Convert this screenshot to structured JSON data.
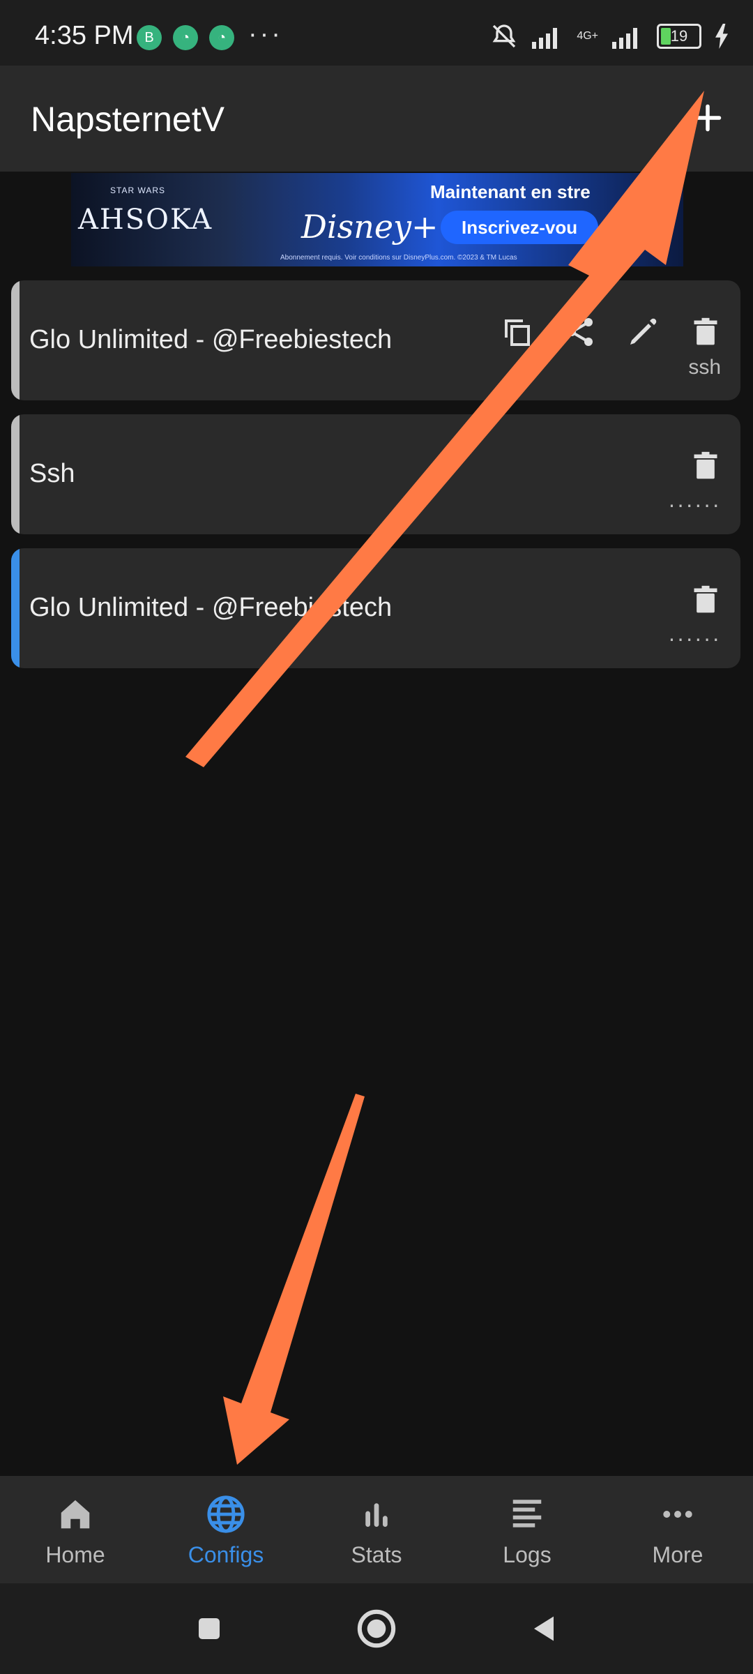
{
  "status_bar": {
    "time": "4:35 PM",
    "overflow": "···",
    "network": "4G+",
    "battery": "19"
  },
  "app_bar": {
    "title": "NapsternetV"
  },
  "ad": {
    "brand_small": "STAR WARS",
    "show": "AHSOKA",
    "disney": "Disney+",
    "headline": "Maintenant en stre",
    "cta": "Inscrivez-vou",
    "fine_print": "Abonnement requis. Voir conditions sur DisneyPlus.com. ©2023 & TM Lucas"
  },
  "configs": [
    {
      "title": "Glo Unlimited - @Freebiestech",
      "tag": "ssh",
      "expanded": true,
      "selected": false
    },
    {
      "title": "Ssh",
      "tag": "······",
      "expanded": false,
      "selected": false
    },
    {
      "title": "Glo Unlimited - @Freebiestech",
      "tag": "······",
      "expanded": false,
      "selected": true
    }
  ],
  "bottom_nav": {
    "items": [
      {
        "label": "Home",
        "icon": "home-icon"
      },
      {
        "label": "Configs",
        "icon": "globe-icon",
        "active": true
      },
      {
        "label": "Stats",
        "icon": "bar-chart-icon"
      },
      {
        "label": "Logs",
        "icon": "list-lines-icon"
      },
      {
        "label": "More",
        "icon": "more-dots-icon"
      }
    ]
  },
  "colors": {
    "accent": "#3a8fe8",
    "annotation": "#ff7a45",
    "card": "#2a2a2a",
    "background": "#121212"
  }
}
